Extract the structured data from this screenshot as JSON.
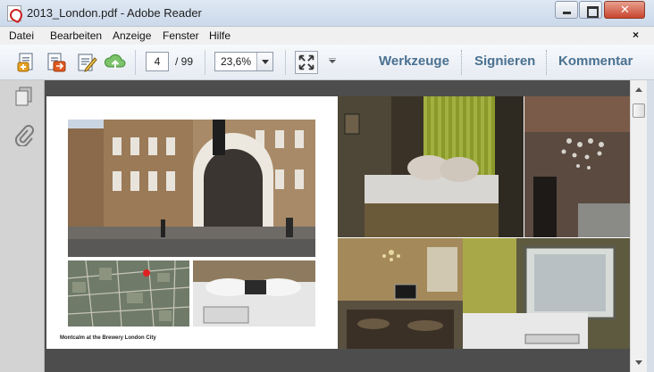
{
  "window": {
    "title": "2013_London.pdf - Adobe Reader"
  },
  "menu": {
    "items": [
      "Datei",
      "Bearbeiten",
      "Anzeige",
      "Fenster",
      "Hilfe"
    ],
    "close_glyph": "×"
  },
  "toolbar": {
    "page_current": "4",
    "page_total": "/ 99",
    "zoom": "23,6%",
    "links": [
      "Werkzeuge",
      "Signieren",
      "Kommentar"
    ]
  },
  "icons": {
    "app": "adobe-reader-icon",
    "tb": [
      "create-pdf-icon",
      "export-pdf-icon",
      "edit-form-icon",
      "cloud-upload-icon",
      "fit-page-icon"
    ],
    "nav": [
      "page-thumbnails-icon",
      "attachments-icon"
    ]
  },
  "document": {
    "caption": "Montcalm at the Brewery London City"
  },
  "colors": {
    "link": "#4a7191",
    "doc_bg": "#4d4d4d"
  }
}
